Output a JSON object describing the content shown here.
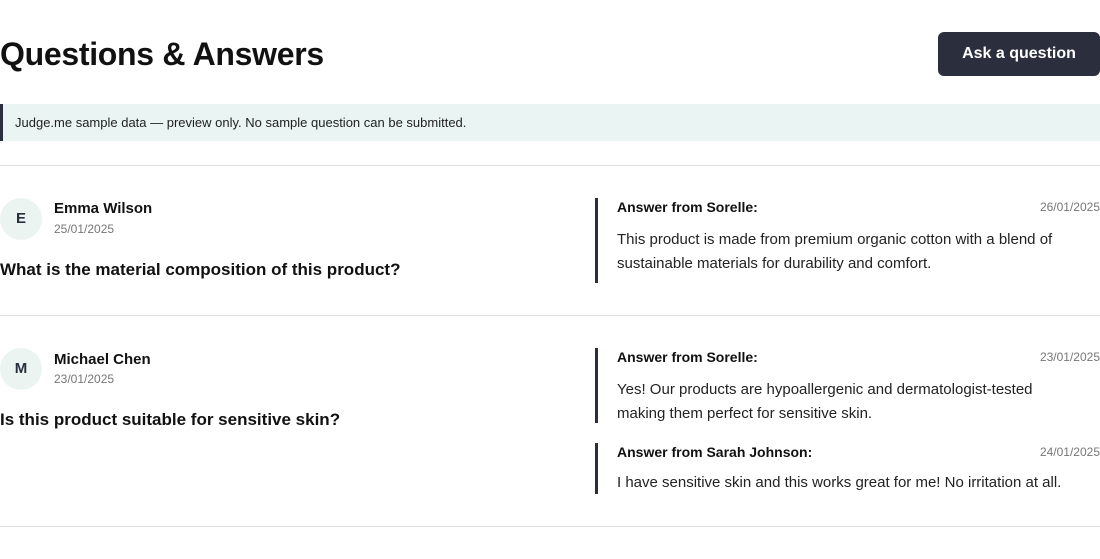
{
  "header": {
    "title": "Questions & Answers",
    "ask_button_label": "Ask a question"
  },
  "notice": {
    "text": "Judge.me sample data — preview only. No sample question can be submitted."
  },
  "colors": {
    "primary": "#2b2f3d",
    "notice_background": "#eaf4f3",
    "avatar_background": "#ecf4f2",
    "divider": "#dddddd"
  },
  "questions": [
    {
      "avatar_initial": "E",
      "author": "Emma Wilson",
      "date": "25/01/2025",
      "question": "What is the material composition of this product?",
      "answers": [
        {
          "from": "Answer from Sorelle:",
          "date": "26/01/2025",
          "body": "This product is made from premium organic cotton with a blend of sustainable materials for durability and comfort."
        }
      ]
    },
    {
      "avatar_initial": "M",
      "author": "Michael Chen",
      "date": "23/01/2025",
      "question": "Is this product suitable for sensitive skin?",
      "answers": [
        {
          "from": "Answer from Sorelle:",
          "date": "23/01/2025",
          "body": "Yes! Our products are hypoallergenic and dermatologist-tested making them perfect for sensitive skin."
        },
        {
          "from": "Answer from Sarah Johnson:",
          "date": "24/01/2025",
          "body": "I have sensitive skin and this works great for me! No irritation at all."
        }
      ]
    }
  ]
}
